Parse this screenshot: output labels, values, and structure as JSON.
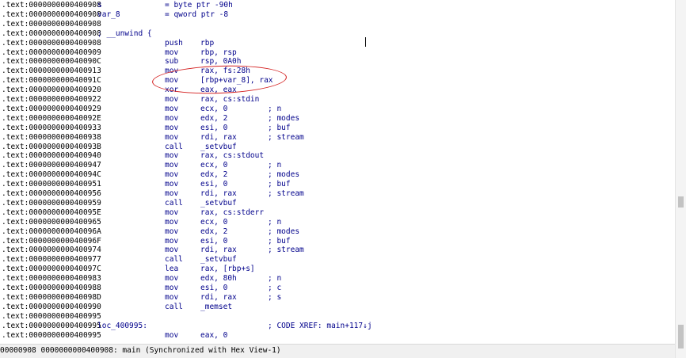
{
  "lines": [
    {
      "addr": ".text:0000000000400908",
      "label": "s",
      "eq": "= byte ptr -90h"
    },
    {
      "addr": ".text:0000000000400908",
      "label": "var_8",
      "eq": "= qword ptr -8"
    },
    {
      "addr": ".text:0000000000400908"
    },
    {
      "addr": ".text:0000000000400908",
      "label": "; __unwind {"
    },
    {
      "addr": ".text:0000000000400908",
      "mnem": "push",
      "ops": "rbp"
    },
    {
      "addr": ".text:0000000000400909",
      "mnem": "mov",
      "ops": "rbp, rsp"
    },
    {
      "addr": ".text:000000000040090C",
      "mnem": "sub",
      "ops": "rsp, 0A0h"
    },
    {
      "addr": ".text:0000000000400913",
      "mnem": "mov",
      "ops": "rax, fs:28h"
    },
    {
      "addr": ".text:000000000040091C",
      "mnem": "mov",
      "ops": "[rbp+var_8], rax"
    },
    {
      "addr": ".text:0000000000400920",
      "mnem": "xor",
      "ops": "eax, eax"
    },
    {
      "addr": ".text:0000000000400922",
      "mnem": "mov",
      "ops": "rax, cs:stdin"
    },
    {
      "addr": ".text:0000000000400929",
      "mnem": "mov",
      "ops": "ecx, 0",
      "cmt": "; n"
    },
    {
      "addr": ".text:000000000040092E",
      "mnem": "mov",
      "ops": "edx, 2",
      "cmt": "; modes"
    },
    {
      "addr": ".text:0000000000400933",
      "mnem": "mov",
      "ops": "esi, 0",
      "cmt": "; buf"
    },
    {
      "addr": ".text:0000000000400938",
      "mnem": "mov",
      "ops": "rdi, rax",
      "cmt": "; stream"
    },
    {
      "addr": ".text:000000000040093B",
      "mnem": "call",
      "ops": "_setvbuf"
    },
    {
      "addr": ".text:0000000000400940",
      "mnem": "mov",
      "ops": "rax, cs:stdout"
    },
    {
      "addr": ".text:0000000000400947",
      "mnem": "mov",
      "ops": "ecx, 0",
      "cmt": "; n"
    },
    {
      "addr": ".text:000000000040094C",
      "mnem": "mov",
      "ops": "edx, 2",
      "cmt": "; modes"
    },
    {
      "addr": ".text:0000000000400951",
      "mnem": "mov",
      "ops": "esi, 0",
      "cmt": "; buf"
    },
    {
      "addr": ".text:0000000000400956",
      "mnem": "mov",
      "ops": "rdi, rax",
      "cmt": "; stream"
    },
    {
      "addr": ".text:0000000000400959",
      "mnem": "call",
      "ops": "_setvbuf"
    },
    {
      "addr": ".text:000000000040095E",
      "mnem": "mov",
      "ops": "rax, cs:stderr"
    },
    {
      "addr": ".text:0000000000400965",
      "mnem": "mov",
      "ops": "ecx, 0",
      "cmt": "; n"
    },
    {
      "addr": ".text:000000000040096A",
      "mnem": "mov",
      "ops": "edx, 2",
      "cmt": "; modes"
    },
    {
      "addr": ".text:000000000040096F",
      "mnem": "mov",
      "ops": "esi, 0",
      "cmt": "; buf"
    },
    {
      "addr": ".text:0000000000400974",
      "mnem": "mov",
      "ops": "rdi, rax",
      "cmt": "; stream"
    },
    {
      "addr": ".text:0000000000400977",
      "mnem": "call",
      "ops": "_setvbuf"
    },
    {
      "addr": ".text:000000000040097C",
      "mnem": "lea",
      "ops": "rax, [rbp+s]"
    },
    {
      "addr": ".text:0000000000400983",
      "mnem": "mov",
      "ops": "edx, 80h",
      "cmt": "; n"
    },
    {
      "addr": ".text:0000000000400988",
      "mnem": "mov",
      "ops": "esi, 0",
      "cmt": "; c"
    },
    {
      "addr": ".text:000000000040098D",
      "mnem": "mov",
      "ops": "rdi, rax",
      "cmt": "; s"
    },
    {
      "addr": ".text:0000000000400990",
      "mnem": "call",
      "ops": "_memset"
    },
    {
      "addr": ".text:0000000000400995"
    },
    {
      "addr": ".text:0000000000400995",
      "label": "loc_400995:",
      "cmt": "; CODE XREF: main+117↓j"
    },
    {
      "addr": ".text:0000000000400995",
      "mnem": "mov",
      "ops": "eax, 0"
    }
  ],
  "status_bar": {
    "text": "00000908 0000000000400908: main (Synchronized with Hex View-1)"
  },
  "colors": {
    "code": "#00008b",
    "address": "#000000",
    "annotation": "#d42020"
  }
}
